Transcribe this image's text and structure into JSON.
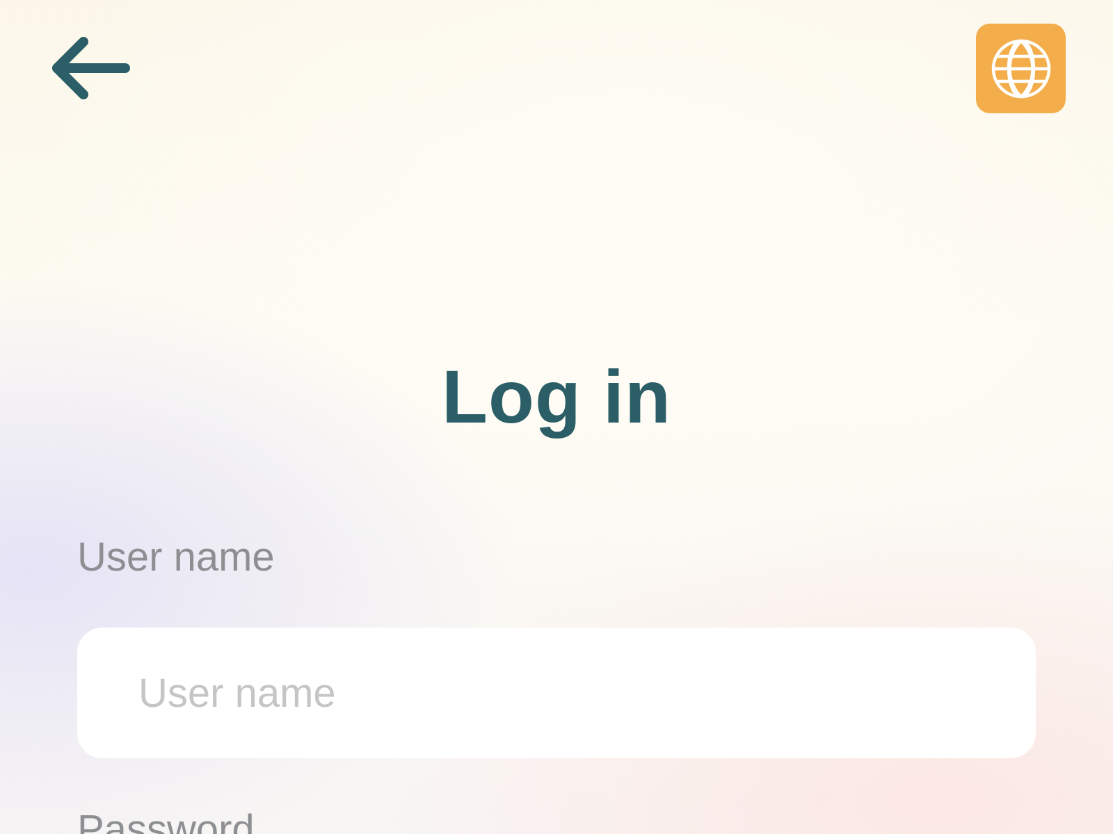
{
  "header": {
    "back_icon": "arrow-left-icon",
    "language_icon": "globe-icon",
    "language_button_color": "#f3ae4b",
    "icon_color": "#2b5e66"
  },
  "main": {
    "title": "Log in",
    "username": {
      "label": "User name",
      "placeholder": "User name",
      "value": ""
    },
    "password": {
      "label": "Password"
    }
  }
}
